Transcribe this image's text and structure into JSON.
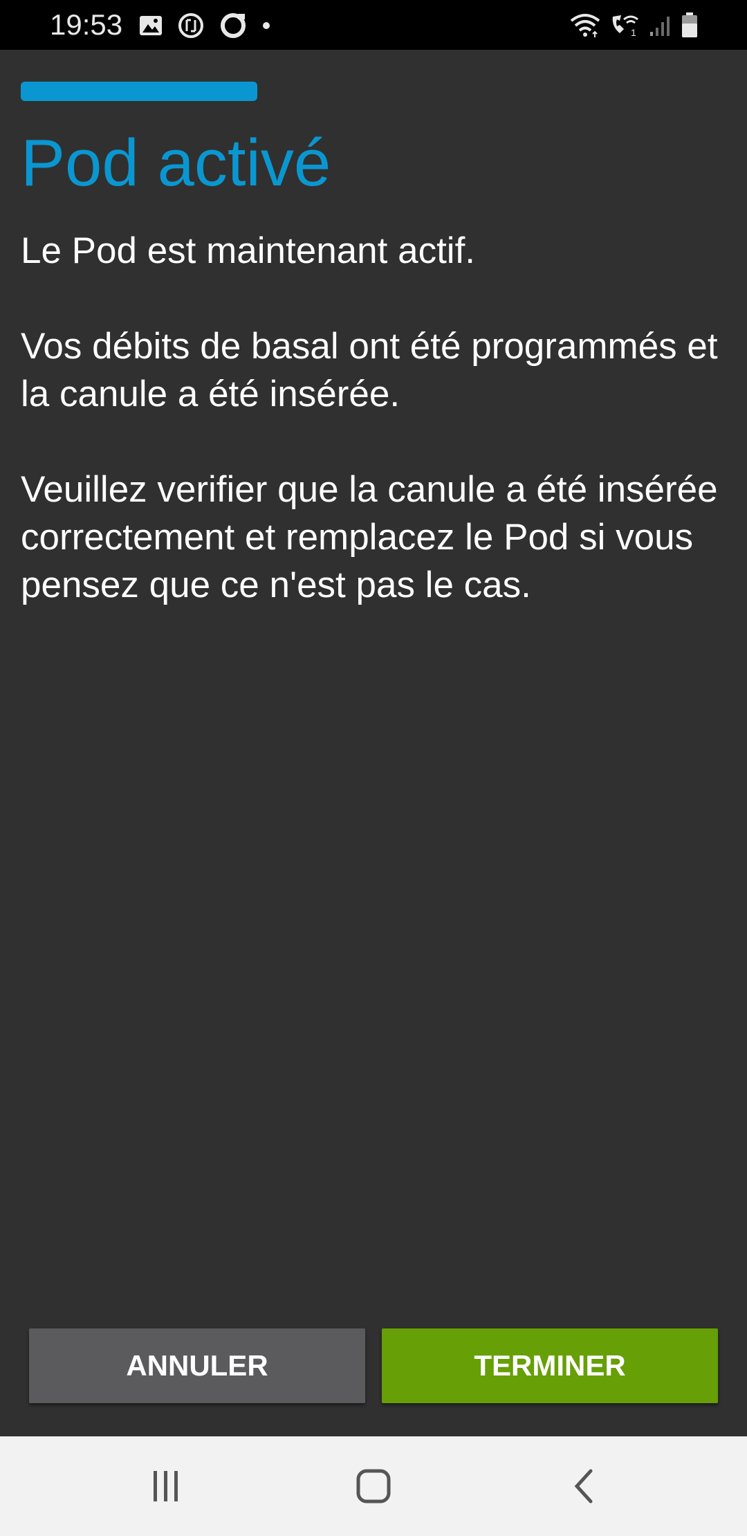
{
  "status_bar": {
    "time": "19:53",
    "left_icons": [
      "image-icon",
      "sync-icon",
      "circle-icon",
      "dot-icon"
    ],
    "right_icons": [
      "wifi-icon",
      "wifi-call-icon",
      "signal-icon",
      "battery-icon"
    ]
  },
  "progress": {
    "value": 0.57,
    "color": "#0a97d1"
  },
  "title": "Pod activé",
  "paragraphs": [
    "Le Pod est maintenant actif.",
    "Vos débits de basal ont été programmés et la canule a été insérée.",
    "Veuillez verifier que la canule a été insérée correctement et remplacez le Pod si vous pensez que ce n'est pas le cas."
  ],
  "buttons": {
    "cancel_label": "ANNULER",
    "finish_label": "TERMINER"
  },
  "colors": {
    "accent": "#0a97d1",
    "finish_button": "#669f06",
    "cancel_button": "#5b5b5d",
    "background": "#303030"
  },
  "nav_bar": {
    "items": [
      "recents-icon",
      "home-icon",
      "back-icon"
    ]
  }
}
